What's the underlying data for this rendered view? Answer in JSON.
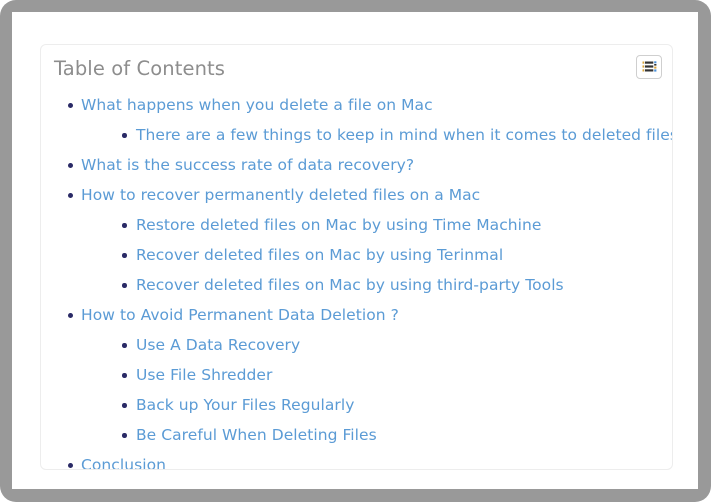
{
  "frame": {
    "outer_color": "#999999",
    "page_color": "#ffffff"
  },
  "toc": {
    "title": "Table of Contents",
    "title_color": "#8d8d8d",
    "link_color": "#5b9bd5",
    "bullet_color": "#2a2a66",
    "toggle_button": {
      "icon": "list-lines-icon",
      "aria_label": "Toggle Table of Contents"
    },
    "items": [
      {
        "label": "What happens when you delete a file on Mac",
        "children": [
          {
            "label": "There are a few things to keep in mind when it comes to deleted files:"
          }
        ]
      },
      {
        "label": "What is the success rate of data recovery?",
        "children": []
      },
      {
        "label": "How to recover permanently deleted files on a Mac",
        "children": [
          {
            "label": "Restore deleted files on Mac by using Time Machine"
          },
          {
            "label": "Recover deleted files on Mac by using Terinmal"
          },
          {
            "label": "Recover deleted files on Mac by using third-party Tools"
          }
        ]
      },
      {
        "label": "How to Avoid Permanent Data Deletion ?",
        "children": [
          {
            "label": "Use A Data Recovery"
          },
          {
            "label": "Use File Shredder"
          },
          {
            "label": "Back up Your Files Regularly"
          },
          {
            "label": "Be Careful When Deleting Files"
          }
        ]
      },
      {
        "label": "Conclusion",
        "children": []
      }
    ]
  }
}
